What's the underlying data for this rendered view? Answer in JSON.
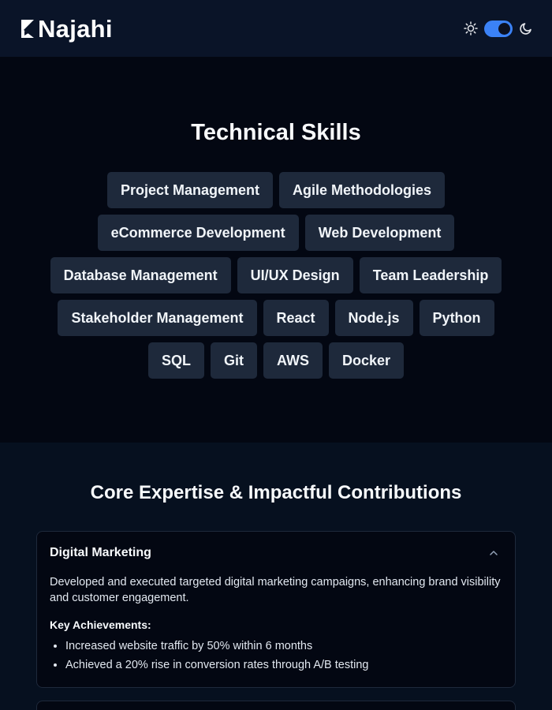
{
  "header": {
    "brand": "Najahi",
    "icons": {
      "logo": "najahi-logo-icon",
      "light": "sun-icon",
      "dark": "moon-icon"
    },
    "theme_toggle": {
      "state": "on",
      "accent": "#3b82f6"
    }
  },
  "skills": {
    "title": "Technical Skills",
    "items": [
      "Project Management",
      "Agile Methodologies",
      "eCommerce Development",
      "Web Development",
      "Database Management",
      "UI/UX Design",
      "Team Leadership",
      "Stakeholder Management",
      "React",
      "Node.js",
      "Python",
      "SQL",
      "Git",
      "AWS",
      "Docker"
    ]
  },
  "expertise": {
    "title": "Core Expertise & Impactful Contributions",
    "cards": [
      {
        "title": "Digital Marketing",
        "expanded": true,
        "icon": "chevron-up-icon",
        "description": "Developed and executed targeted digital marketing campaigns, enhancing brand visibility and customer engagement.",
        "achievements_label": "Key Achievements:",
        "achievements": [
          "Increased website traffic by 50% within 6 months",
          "Achieved a 20% rise in conversion rates through A/B testing"
        ]
      }
    ]
  },
  "colors": {
    "header_bg": "#0a1428",
    "page_bg": "#030712",
    "section_bg": "#06101f",
    "chip_bg": "#1e293b",
    "border": "#1e293b"
  }
}
